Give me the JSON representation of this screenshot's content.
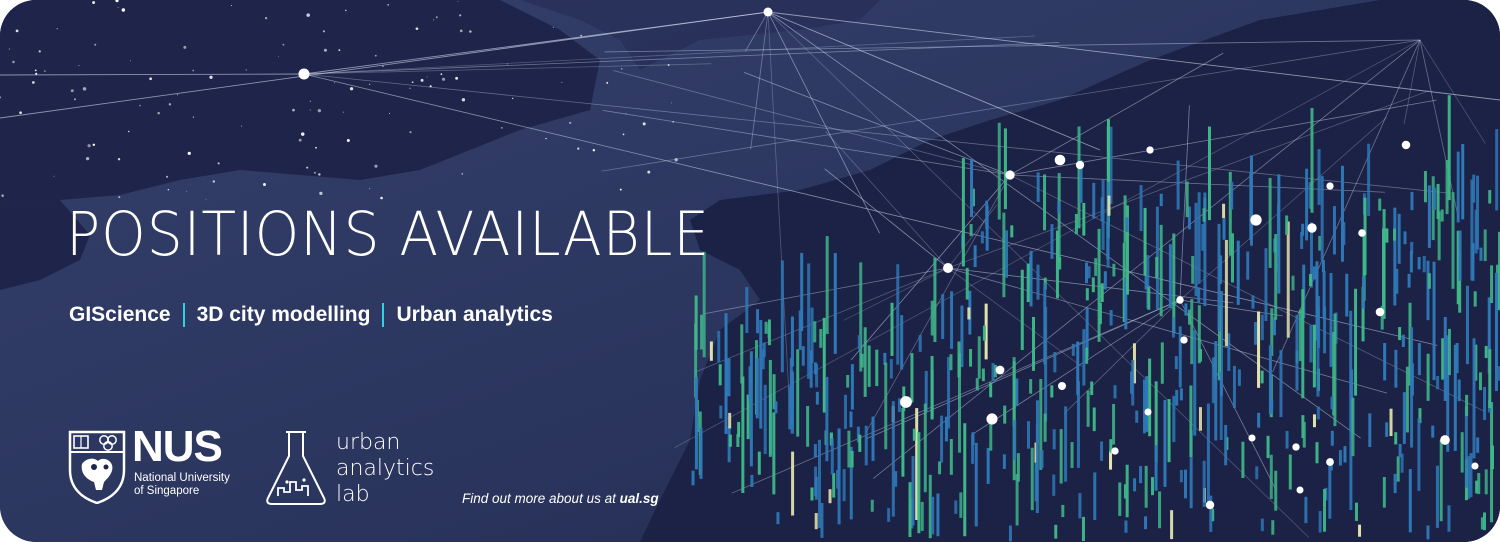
{
  "headline": "POSITIONS AVAILABLE",
  "topics": [
    "GIScience",
    "3D city modelling",
    "Urban analytics"
  ],
  "nus": {
    "wordmark": "NUS",
    "line1": "National University",
    "line2": "of Singapore"
  },
  "lab": {
    "line1": "urban",
    "line2": "analytics",
    "line3": "lab"
  },
  "findout": {
    "prefix": "Find out more about us at ",
    "link": "ual.sg"
  },
  "colors": {
    "background": "#2a3356",
    "land": "#1e2448",
    "accent": "#2fd3e0",
    "bar_blue": "#2f79b8",
    "bar_green": "#3fb88a",
    "bar_highlight": "#e8e7b0"
  }
}
